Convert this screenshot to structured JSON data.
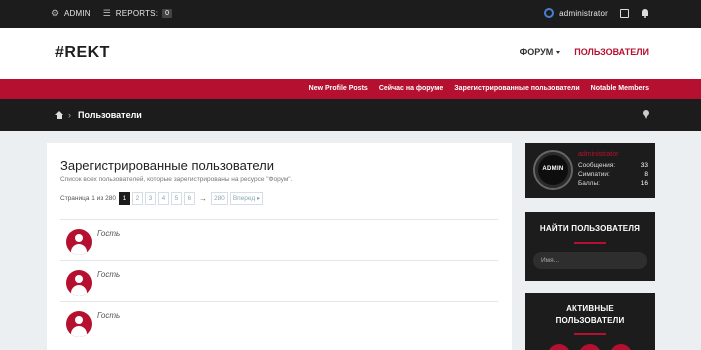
{
  "topbar": {
    "admin_label": "ADMIN",
    "reports_label": "REPORTS:",
    "reports_count": "0",
    "username": "administrator"
  },
  "header": {
    "logo": "#REKT",
    "nav": [
      {
        "label": "ФОРУМ",
        "active": false,
        "has_dropdown": true
      },
      {
        "label": "ПОЛЬЗОВАТЕЛИ",
        "active": true
      }
    ]
  },
  "subnav": {
    "links": [
      "New Profile Posts",
      "Сейчас на форуме",
      "Зарегистрированные пользователи",
      "Notable Members"
    ]
  },
  "breadcrumb": {
    "current": "Пользователи"
  },
  "main": {
    "title": "Зарегистрированные пользователи",
    "description": "Список всех пользователей, которые зарегистрированы на ресурсе \"Форум\".",
    "pager": {
      "label": "Страница 1 из 280",
      "pages": [
        "1",
        "2",
        "3",
        "4",
        "5",
        "6"
      ],
      "current": "1",
      "last": "280",
      "next_label": "Вперед ▸"
    },
    "members": [
      {
        "name": "Гость"
      },
      {
        "name": "Гость"
      },
      {
        "name": "Гость"
      }
    ]
  },
  "sidebar": {
    "user": {
      "avatar_text": "ADMIN",
      "name": "administrator",
      "stats": [
        {
          "label": "Сообщения:",
          "value": "33"
        },
        {
          "label": "Симпатии:",
          "value": "8"
        },
        {
          "label": "Баллы:",
          "value": "16"
        }
      ]
    },
    "find": {
      "title": "НАЙТИ ПОЛЬЗОВАТЕЛЯ",
      "placeholder": "Имя..."
    },
    "active": {
      "title_line1": "АКТИВНЫЕ",
      "title_line2": "ПОЛЬЗОВАТЕЛИ"
    }
  },
  "colors": {
    "accent": "#b5102f",
    "dark": "#1c1c1c",
    "page_bg": "#eceff1"
  }
}
